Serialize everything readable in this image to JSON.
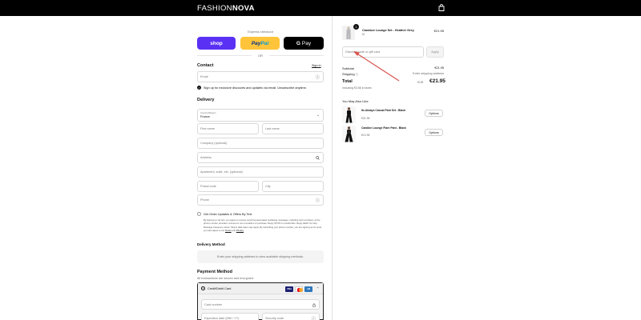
{
  "brand": {
    "logo_part1": "FASHION",
    "logo_part2": "NOVA"
  },
  "express": {
    "label": "Express checkout",
    "shop_label": "shop",
    "paypal_part1": "Pay",
    "paypal_part2": "Pal",
    "gpay_g": "G",
    "gpay_label": "Pay",
    "or_label": "OR"
  },
  "contact": {
    "title": "Contact",
    "signin": "Sign in",
    "email_placeholder": "Email",
    "optin_label": "Sign up for exclusive discounts and updates via email. Unsubscribe anytime."
  },
  "delivery": {
    "title": "Delivery",
    "country_label": "Country/Region",
    "country_value": "France",
    "first_name": "First name",
    "last_name": "Last name",
    "company": "Company (optional)",
    "address": "Address",
    "apartment": "Apartment, suite, etc. (optional)",
    "postal_code": "Postal code",
    "city": "City",
    "phone": "Phone",
    "sms_label": "Get Order Updates & Offers By Text",
    "legal_text": "By signing up via text, you agree to receive recurring automated marketing messages, including cart reminders, at the phone number provided. Consent is not a condition of purchase. Reply STOP to unsubscribe. Reply HELP for help. Message frequency varies. Msg & data rates may apply. By submitting your phone number, you are signing up for texts, you also agree to our",
    "legal_terms": "Terms",
    "legal_and": "and",
    "legal_privacy": "Privacy"
  },
  "delivery_method": {
    "title": "Delivery Method",
    "placeholder": "Enter your shipping address to view available shipping methods."
  },
  "payment": {
    "title": "Payment Method",
    "subtitle": "All transactions are secure and encrypted.",
    "option_label": "Credit/Debit Card",
    "visa": "VISA",
    "amex": "AM",
    "card_number": "Card number",
    "expiry": "Expiration date (MM / YY)",
    "security_code": "Security code"
  },
  "cart": {
    "item": {
      "quantity": "1",
      "name": "Candace Lounge Set - Heather Grey",
      "variant": "M",
      "price": "€21.95"
    },
    "discount_placeholder": "Discount code or gift card",
    "apply_label": "Apply",
    "subtotal_label": "Subtotal",
    "subtotal_value": "€21.95",
    "shipping_label": "Shipping",
    "shipping_value": "Enter shipping address",
    "total_label": "Total",
    "total_currency": "EUR",
    "total_value": "€21.95",
    "tax_note": "Including €3.66 in taxes"
  },
  "recommendations": {
    "title": "You May Also Like",
    "items": [
      {
        "name": "Its Always Casual Pant Set - Black",
        "price": "€31.95",
        "button": "Options"
      },
      {
        "name": "Candice Lounge Flare Pant - Black",
        "price": "€12.95",
        "button": "Options"
      }
    ]
  },
  "colors": {
    "shop": "#5a31f4",
    "paypal": "#ffc439",
    "annotation_arrow": "#d9534f"
  }
}
